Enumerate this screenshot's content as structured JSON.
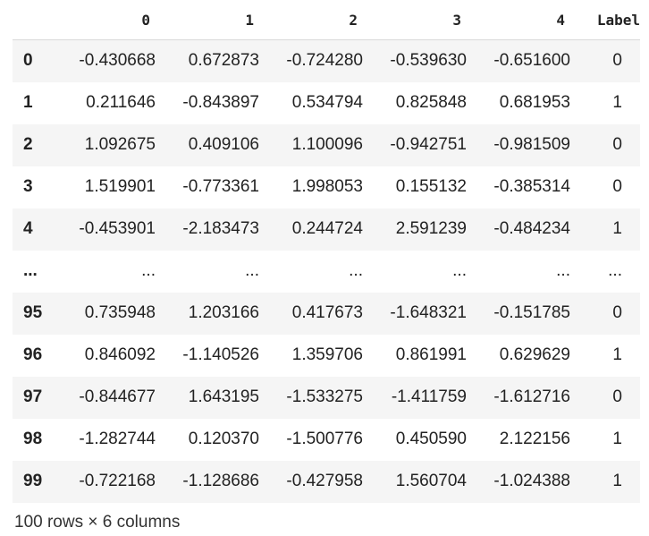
{
  "table": {
    "columns": [
      "0",
      "1",
      "2",
      "3",
      "4",
      "Label"
    ],
    "rows": [
      {
        "index": "0",
        "values": [
          "-0.430668",
          "0.672873",
          "-0.724280",
          "-0.539630",
          "-0.651600",
          "0"
        ]
      },
      {
        "index": "1",
        "values": [
          "0.211646",
          "-0.843897",
          "0.534794",
          "0.825848",
          "0.681953",
          "1"
        ]
      },
      {
        "index": "2",
        "values": [
          "1.092675",
          "0.409106",
          "1.100096",
          "-0.942751",
          "-0.981509",
          "0"
        ]
      },
      {
        "index": "3",
        "values": [
          "1.519901",
          "-0.773361",
          "1.998053",
          "0.155132",
          "-0.385314",
          "0"
        ]
      },
      {
        "index": "4",
        "values": [
          "-0.453901",
          "-2.183473",
          "0.244724",
          "2.591239",
          "-0.484234",
          "1"
        ]
      },
      {
        "index": "...",
        "values": [
          "...",
          "...",
          "...",
          "...",
          "...",
          "..."
        ]
      },
      {
        "index": "95",
        "values": [
          "0.735948",
          "1.203166",
          "0.417673",
          "-1.648321",
          "-0.151785",
          "0"
        ]
      },
      {
        "index": "96",
        "values": [
          "0.846092",
          "-1.140526",
          "1.359706",
          "0.861991",
          "0.629629",
          "1"
        ]
      },
      {
        "index": "97",
        "values": [
          "-0.844677",
          "1.643195",
          "-1.533275",
          "-1.411759",
          "-1.612716",
          "0"
        ]
      },
      {
        "index": "98",
        "values": [
          "-1.282744",
          "0.120370",
          "-1.500776",
          "0.450590",
          "2.122156",
          "1"
        ]
      },
      {
        "index": "99",
        "values": [
          "-0.722168",
          "-1.128686",
          "-0.427958",
          "1.560704",
          "-1.024388",
          "1"
        ]
      }
    ]
  },
  "footer": {
    "shape_text": "100 rows × 6 columns"
  },
  "colors": {
    "stripe": "#f5f5f5",
    "text": "#222222",
    "header_rule": "#d8d8d8"
  }
}
